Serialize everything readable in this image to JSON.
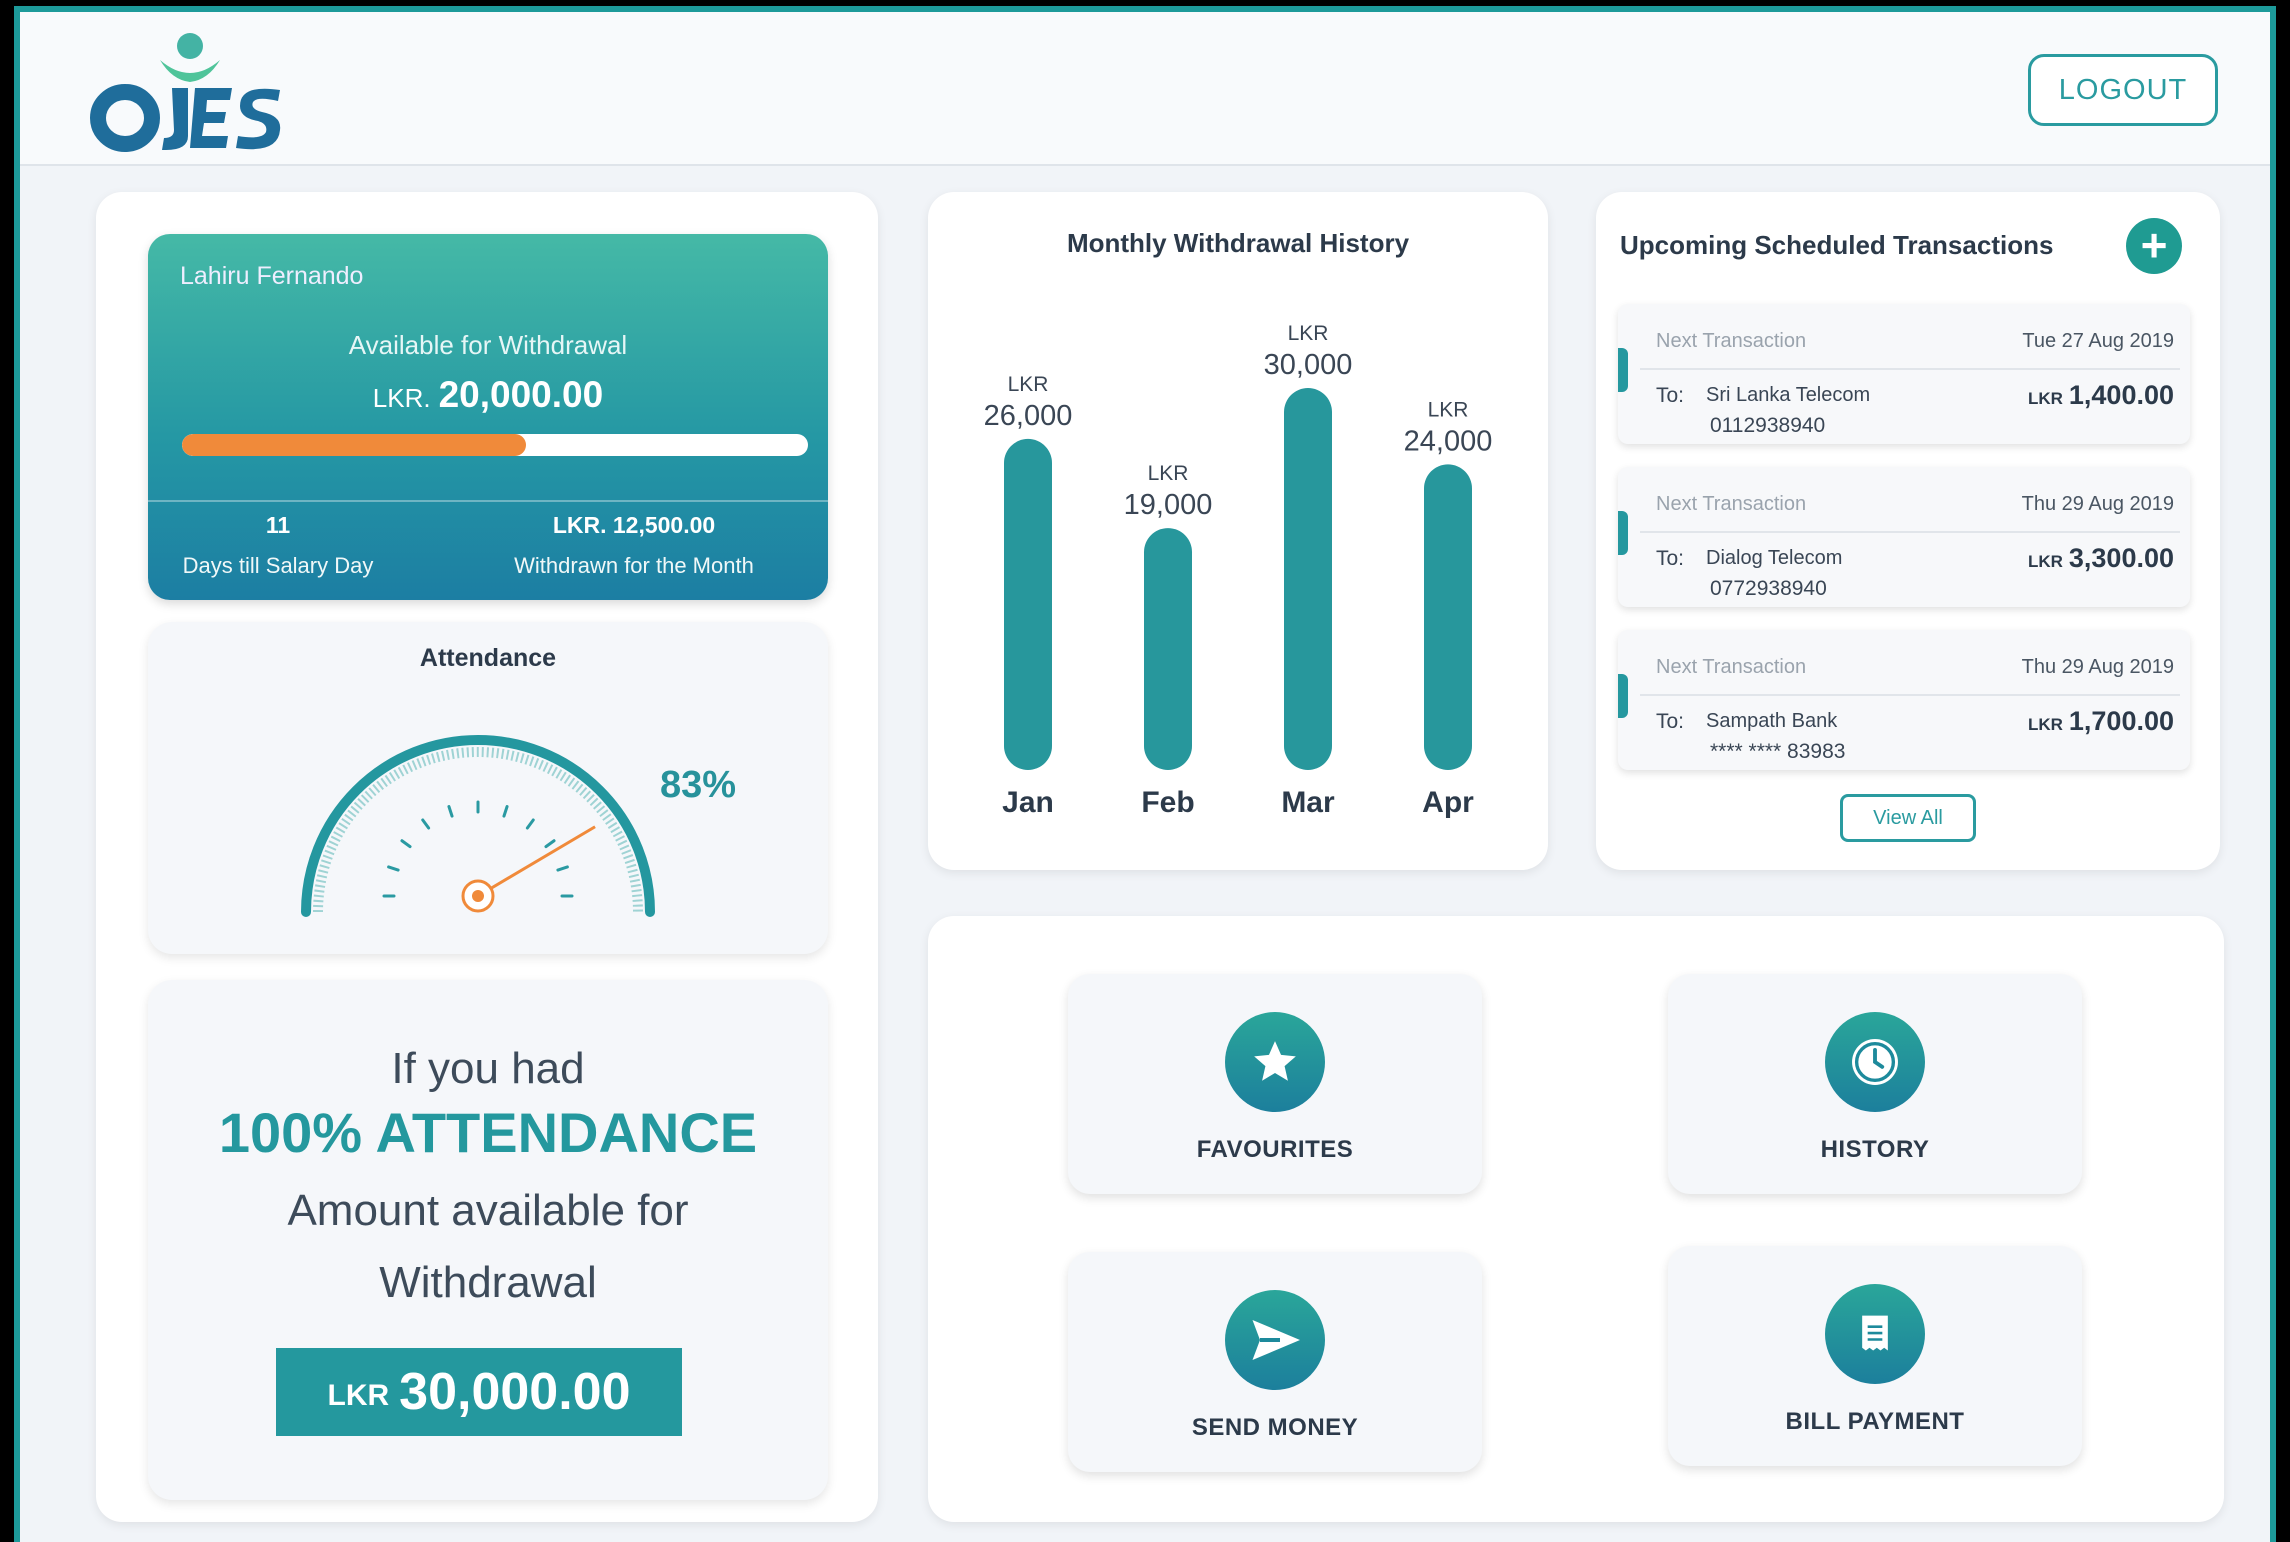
{
  "header": {
    "logo_text": "OYES",
    "logout_label": "LOGOUT"
  },
  "withdrawal_card": {
    "user_name": "Lahiru Fernando",
    "available_label": "Available for Withdrawal",
    "currency": "LKR.",
    "available_amount": "20,000.00",
    "progress_fraction": 0.55,
    "days_value": "11",
    "days_label": "Days till Salary Day",
    "withdrawn_value": "LKR. 12,500.00",
    "withdrawn_label": "Withdrawn for the Month"
  },
  "attendance": {
    "title": "Attendance",
    "percent_label": "83%",
    "percent": 83
  },
  "promo": {
    "line1": "If you had",
    "line2": "100% ATTENDANCE",
    "line3": "Amount available for",
    "line4": "Withdrawal",
    "currency": "LKR",
    "amount": "30,000.00"
  },
  "chart_data": {
    "type": "bar",
    "title": "Monthly Withdrawal History",
    "categories": [
      "Jan",
      "Feb",
      "Mar",
      "Apr"
    ],
    "values": [
      26000,
      19000,
      30000,
      24000
    ],
    "value_labels": [
      "26,000",
      "19,000",
      "30,000",
      "24,000"
    ],
    "unit_label": "LKR",
    "ylim": [
      0,
      30000
    ],
    "grid": false,
    "bar_color": "#27979c"
  },
  "scheduled": {
    "title": "Upcoming Scheduled Transactions",
    "add_icon": "plus-icon",
    "transactions": [
      {
        "next_label": "Next Transaction",
        "date": "Tue 27 Aug 2019",
        "to_label": "To:",
        "name": "Sri Lanka Telecom",
        "account": "0112938940",
        "currency": "LKR",
        "amount": "1,400.00"
      },
      {
        "next_label": "Next Transaction",
        "date": "Thu 29 Aug 2019",
        "to_label": "To:",
        "name": "Dialog Telecom",
        "account": "0772938940",
        "currency": "LKR",
        "amount": "3,300.00"
      },
      {
        "next_label": "Next Transaction",
        "date": "Thu 29 Aug 2019",
        "to_label": "To:",
        "name": "Sampath Bank",
        "account": "**** **** 83983",
        "currency": "LKR",
        "amount": "1,700.00"
      }
    ],
    "view_all_label": "View All"
  },
  "quick_actions": [
    {
      "label": "FAVOURITES",
      "icon": "star-icon"
    },
    {
      "label": "HISTORY",
      "icon": "clock-icon"
    },
    {
      "label": "SEND MONEY",
      "icon": "send-icon"
    },
    {
      "label": "BILL PAYMENT",
      "icon": "receipt-icon"
    }
  ],
  "colors": {
    "accent": "#27979c",
    "frame_border": "#1d9a9a",
    "progress_fill": "#f08a3a",
    "gauge_needle": "#f08a3a"
  }
}
